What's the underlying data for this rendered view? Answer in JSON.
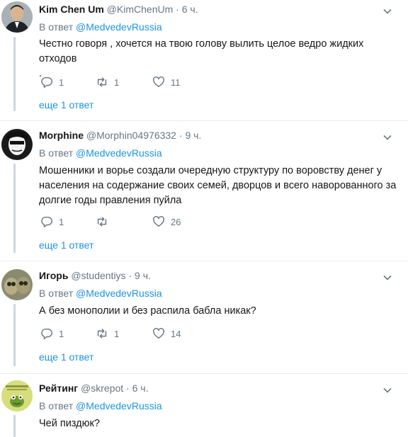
{
  "tweets": [
    {
      "name": "Kim Chen Um",
      "handle": "@KimChenUm",
      "time": "6 ч.",
      "reply_prefix": "В ответ",
      "reply_to": "@MedvedevRussia",
      "text_lines": [
        "Честно говоря , хочется на  твою голову  вылить целое ведро  жидких отходов",
        "."
      ],
      "replies": "1",
      "retweets": "1",
      "likes": "11",
      "more_replies": "еще 1 ответ",
      "avatar": "portrait-man-dark-suit"
    },
    {
      "name": "Morphine",
      "handle": "@Morphin04976332",
      "time": "9 ч.",
      "reply_prefix": "В ответ",
      "reply_to": "@MedvedevRussia",
      "text_lines": [
        "Мошенники и ворье создали очередную структуру по воровству денег у",
        "населения на содержание своих семей, дворцов и всего наворованного за",
        "долгие годы правления пуйла"
      ],
      "replies": "1",
      "retweets": "",
      "likes": "26",
      "more_replies": "еще 1 ответ",
      "avatar": "black-white-face"
    },
    {
      "name": "Игорь",
      "handle": "@studentiys",
      "time": "9 ч.",
      "reply_prefix": "В ответ",
      "reply_to": "@MedvedevRussia",
      "text_lines": [
        "А без монополии и без распила бабла никак?"
      ],
      "replies": "1",
      "retweets": "1",
      "likes": "14",
      "more_replies": "еще 1 ответ",
      "avatar": "owls"
    },
    {
      "name": "Рейтинг",
      "handle": "@skrepot",
      "time": "6 ч.",
      "reply_prefix": "В ответ",
      "reply_to": "@MedvedevRussia",
      "text_lines": [
        "Чей пиздюк?"
      ],
      "avatar": "green-frog-logo"
    }
  ],
  "icons": {
    "reply": "reply-icon",
    "retweet": "retweet-icon",
    "like": "heart-icon",
    "menu": "chevron-down-icon"
  },
  "colors": {
    "link": "#1b95e0",
    "muted": "#657786",
    "thread_line": "#ccd6dd"
  }
}
